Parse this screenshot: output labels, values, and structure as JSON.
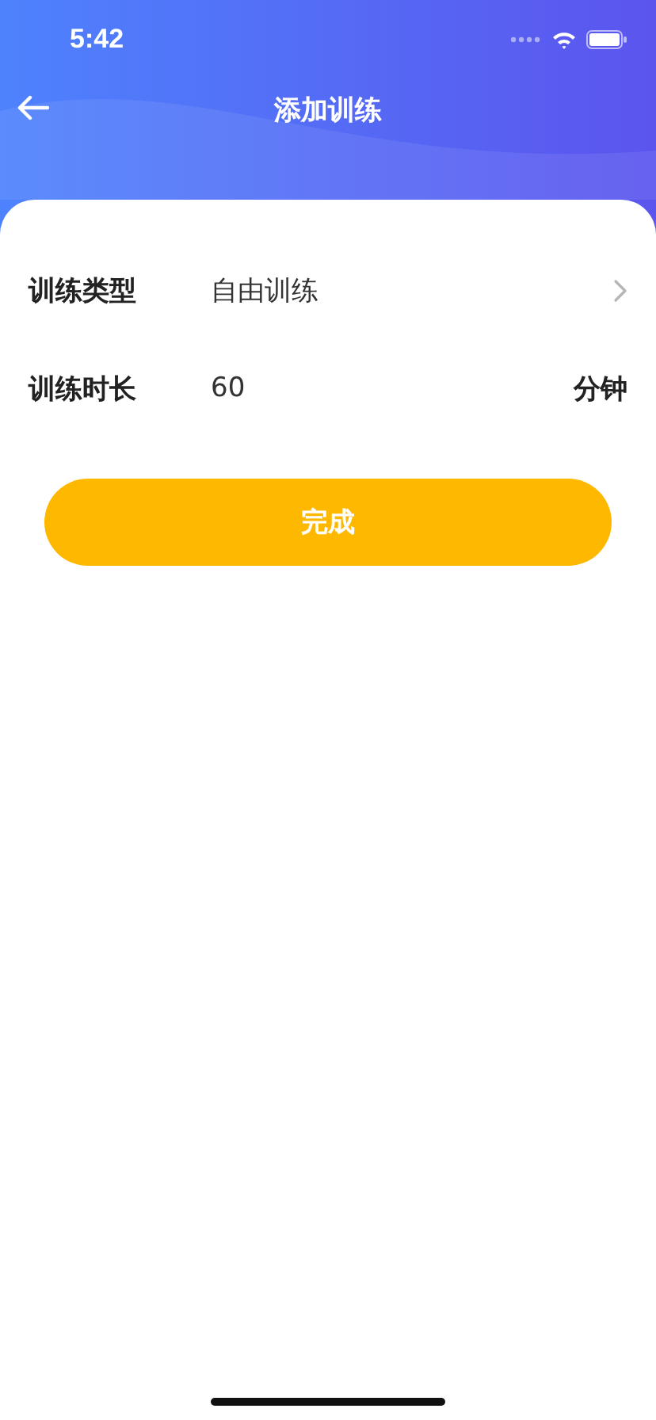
{
  "status_bar": {
    "time": "5:42"
  },
  "header": {
    "title": "添加训练"
  },
  "form": [
    {
      "kind": "select",
      "label": "训练类型",
      "value": "自由训练"
    },
    {
      "kind": "input",
      "label": "训练时长",
      "value": "60",
      "unit": "分钟"
    }
  ],
  "submit_button": "完成"
}
